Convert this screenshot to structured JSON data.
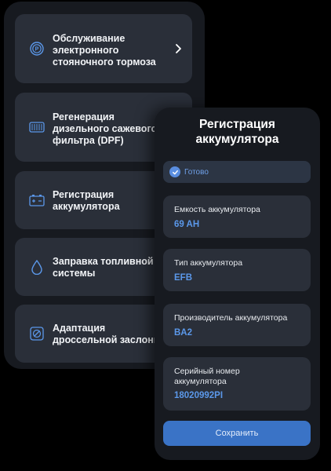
{
  "menu": {
    "items": [
      {
        "label": "Обслуживание\nэлектронного\nстояночного тормоза",
        "icon": "parking-brake-icon",
        "has_chevron": true
      },
      {
        "label": "Регенерация\nдизельного сажевого\nфильтра (DPF)",
        "icon": "dpf-filter-icon",
        "has_chevron": false
      },
      {
        "label": "Регистрация\nаккумулятора",
        "icon": "battery-icon",
        "has_chevron": false
      },
      {
        "label": "Заправка топливной\nсистемы",
        "icon": "fuel-drop-icon",
        "has_chevron": false
      },
      {
        "label": "Адаптация\nдроссельной заслонки",
        "icon": "throttle-icon",
        "has_chevron": false
      }
    ]
  },
  "battery_registration": {
    "title": "Регистрация\nаккумулятора",
    "status": "Готово",
    "fields": [
      {
        "label": "Емкость аккумулятора",
        "value": "69 AH"
      },
      {
        "label": "Тип аккумулятора",
        "value": "EFB"
      },
      {
        "label": "Производитель аккумулятора",
        "value": "BA2"
      },
      {
        "label": "Серийный номер\nаккумулятора",
        "value": "18020992PI"
      }
    ],
    "save_label": "Сохранить"
  },
  "colors": {
    "background": "#000000",
    "panel": "#171a20",
    "card": "#2a2f39",
    "accent": "#3a73c6",
    "value_text": "#5b98ea"
  }
}
